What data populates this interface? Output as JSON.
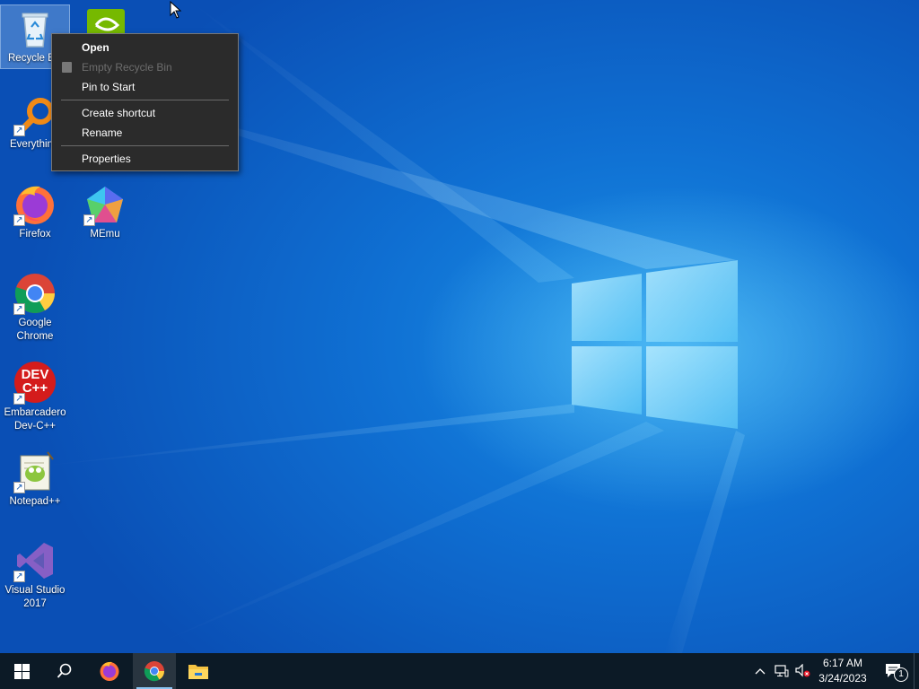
{
  "desktop": {
    "icons": [
      {
        "label": "Recycle Bin",
        "icon": "recycle-bin-icon"
      },
      {
        "label": "",
        "icon": "nvidia-icon"
      },
      {
        "label": "Everything",
        "icon": "everything-search-icon"
      },
      {
        "label": "Firefox",
        "icon": "firefox-icon"
      },
      {
        "label": "MEmu",
        "icon": "memu-icon"
      },
      {
        "label": "Google Chrome",
        "icon": "chrome-icon"
      },
      {
        "label": "Embarcadero Dev-C++",
        "icon": "devcpp-icon"
      },
      {
        "label": "Notepad++",
        "icon": "notepadpp-icon"
      },
      {
        "label": "Visual Studio 2017",
        "icon": "visual-studio-icon"
      }
    ],
    "recycle_label_visible": "Recycle B",
    "everything_label_visible": "Everythin",
    "chrome_label_line1": "Google",
    "chrome_label_line2": "Chrome",
    "devcpp_label_line1": "Embarcadero",
    "devcpp_label_line2": "Dev-C++",
    "devcpp_glyph_line1": "DEV",
    "devcpp_glyph_line2": "C++",
    "vs_label_line1": "Visual Studio",
    "vs_label_line2": "2017"
  },
  "context_menu": {
    "open": "Open",
    "empty_recycle_bin": "Empty Recycle Bin",
    "pin_to_start": "Pin to Start",
    "create_shortcut": "Create shortcut",
    "rename": "Rename",
    "properties": "Properties"
  },
  "taskbar": {
    "pinned": [
      "start-icon",
      "search-icon",
      "firefox-icon",
      "chrome-icon",
      "file-explorer-icon"
    ],
    "active_app": "chrome-icon",
    "clock_time": "6:17 AM",
    "clock_date": "3/24/2023",
    "notification_count": "1"
  },
  "colors": {
    "taskbar_bg": "#0c1a26",
    "menu_bg": "#2b2b2b",
    "accent": "#8bc3f2"
  }
}
